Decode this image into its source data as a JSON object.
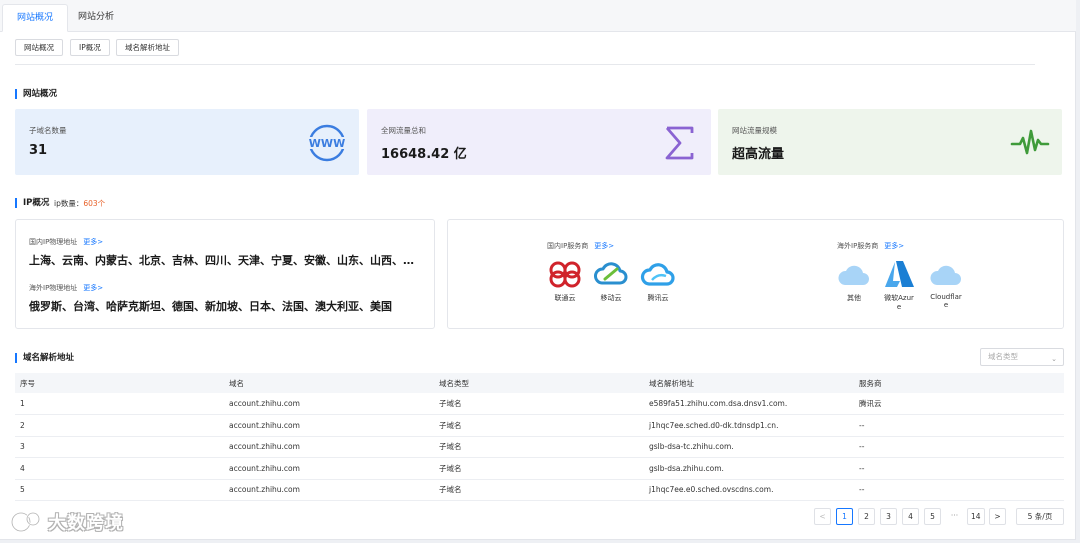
{
  "tabs": [
    {
      "label": "网站概况"
    },
    {
      "label": "网站分析"
    }
  ],
  "sub_buttons": [
    {
      "label": "网站概况"
    },
    {
      "label": "IP概况"
    },
    {
      "label": "域名解析地址"
    }
  ],
  "overview": {
    "title": "网站概况",
    "cards": [
      {
        "label": "子域名数量",
        "value": "31",
        "icon": "www-icon",
        "color": "#3b7de0"
      },
      {
        "label": "全网流量总和",
        "value": "16648.42 亿",
        "icon": "sigma-icon",
        "color": "#8a63d2"
      },
      {
        "label": "网站流量规模",
        "value": "超高流量",
        "icon": "pulse-icon",
        "color": "#3f9b3a"
      }
    ]
  },
  "ip": {
    "title": "IP概况",
    "count_label": "ip数量：",
    "count_value": "603个",
    "domestic_label": "国内IP物理地址",
    "domestic_more": "更多>",
    "domestic_value": "上海、云南、内蒙古、北京、吉林、四川、天津、宁夏、安徽、山东、山西、广东",
    "overseas_label": "海外IP物理地址",
    "overseas_more": "更多>",
    "overseas_value": "俄罗斯、台湾、哈萨克斯坦、德国、新加坡、日本、法国、澳大利亚、美国",
    "domestic_providers_label": "国内IP服务商",
    "domestic_providers_more": "更多>",
    "domestic_providers": [
      {
        "name": "联通云",
        "icon": "unicom-cloud-icon"
      },
      {
        "name": "移动云",
        "icon": "mobile-cloud-icon"
      },
      {
        "name": "腾讯云",
        "icon": "tencent-cloud-icon"
      }
    ],
    "overseas_providers_label": "海外IP服务商",
    "overseas_providers_more": "更多>",
    "overseas_providers": [
      {
        "name": "其他",
        "icon": "cloud-icon"
      },
      {
        "name_line1": "微软Azur",
        "name_line2": "e",
        "icon": "azure-icon"
      },
      {
        "name_line1": "Cloudflar",
        "name_line2": "e",
        "icon": "cloud-icon"
      }
    ]
  },
  "dns": {
    "title": "域名解析地址",
    "select_placeholder": "域名类型",
    "columns": [
      "序号",
      "域名",
      "域名类型",
      "域名解析地址",
      "服务商"
    ],
    "rows": [
      [
        "1",
        "account.zhihu.com",
        "子域名",
        "e589fa51.zhihu.com.dsa.dnsv1.com.",
        "腾讯云"
      ],
      [
        "2",
        "account.zhihu.com",
        "子域名",
        "j1hqc7ee.sched.d0-dk.tdnsdp1.cn.",
        "--"
      ],
      [
        "3",
        "account.zhihu.com",
        "子域名",
        "gslb-dsa-tc.zhihu.com.",
        "--"
      ],
      [
        "4",
        "account.zhihu.com",
        "子域名",
        "gslb-dsa.zhihu.com.",
        "--"
      ],
      [
        "5",
        "account.zhihu.com",
        "子域名",
        "j1hqc7ee.e0.sched.ovscdns.com.",
        "--"
      ]
    ]
  },
  "pagination": {
    "prev": "<",
    "pages": [
      "1",
      "2",
      "3",
      "4",
      "5"
    ],
    "ellipsis": "···",
    "last": "14",
    "next": ">",
    "page_size": "5 条/页",
    "current": 1
  },
  "watermark": "大数跨境",
  "colors": {
    "accent": "#1677ff",
    "count_orange": "#e8622a"
  }
}
